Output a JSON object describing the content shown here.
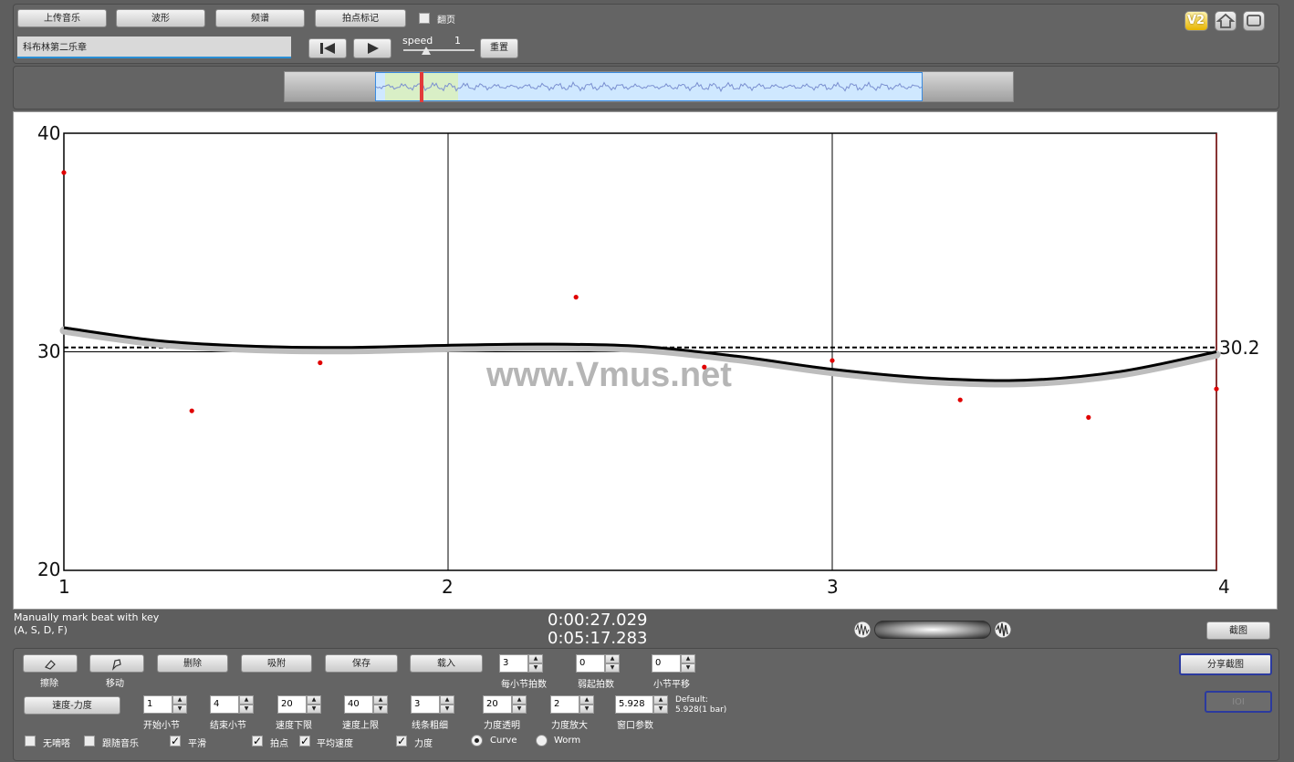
{
  "toolbar": {
    "upload_label": "上传音乐",
    "waveform_label": "波形",
    "spectrum_label": "频谱",
    "beat_mark_label": "拍点标记",
    "page_turn_label": "翻页",
    "reset_label": "重置",
    "speed_label": "speed",
    "speed_value": "1",
    "song_title": "科布林第二乐章"
  },
  "top_icons": {
    "version_badge": "V2",
    "home": "home-icon",
    "fullscreen": "screen-icon"
  },
  "chart_data": {
    "type": "scatter",
    "title": "",
    "xlabel": "",
    "ylabel": "",
    "xlim": [
      1,
      4
    ],
    "ylim": [
      20,
      40
    ],
    "x_ticks": [
      "1",
      "2",
      "3",
      "4"
    ],
    "y_ticks": [
      "20",
      "30",
      "40"
    ],
    "avg_tempo_label": "30.2",
    "avg_tempo": 30.2,
    "watermark": "www.Vmus.net",
    "series": [
      {
        "type": "scatter",
        "color": "#e00000",
        "points": [
          [
            1.0,
            38.2
          ],
          [
            1.333,
            27.3
          ],
          [
            1.667,
            29.5
          ],
          [
            2.333,
            32.5
          ],
          [
            2.667,
            29.3
          ],
          [
            3.0,
            29.6
          ],
          [
            3.333,
            27.8
          ],
          [
            3.667,
            27.0
          ],
          [
            4.0,
            28.3
          ]
        ]
      },
      {
        "type": "line",
        "color": "#000000",
        "points": [
          [
            1.0,
            31.1
          ],
          [
            1.25,
            30.5
          ],
          [
            1.5,
            30.25
          ],
          [
            1.75,
            30.2
          ],
          [
            2.0,
            30.3
          ],
          [
            2.25,
            30.35
          ],
          [
            2.5,
            30.25
          ],
          [
            2.75,
            29.8
          ],
          [
            3.0,
            29.2
          ],
          [
            3.25,
            28.8
          ],
          [
            3.5,
            28.7
          ],
          [
            3.75,
            29.1
          ],
          [
            4.0,
            30.0
          ]
        ]
      }
    ]
  },
  "time": {
    "current": "0:00:27.029",
    "total": "0:05:17.283"
  },
  "hint": {
    "line1": "Manually mark beat with key",
    "line2": "(A, S, D, F)"
  },
  "screenshot_label": "截图",
  "share_label": "分享截图",
  "ioi_label": "IOI",
  "controls": {
    "erase_label": "擦除",
    "move_label": "移动",
    "delete_label": "删除",
    "snap_label": "吸附",
    "save_label": "保存",
    "load_label": "载入",
    "tempo_dyn_label": "速度-力度",
    "beats_per_bar": {
      "label": "每小节拍数",
      "value": "3"
    },
    "upbeat": {
      "label": "弱起拍数",
      "value": "0"
    },
    "bar_shift": {
      "label": "小节平移",
      "value": "0"
    },
    "start_bar": {
      "label": "开始小节",
      "value": "1"
    },
    "end_bar": {
      "label": "结束小节",
      "value": "4"
    },
    "tempo_min": {
      "label": "速度下限",
      "value": "20"
    },
    "tempo_max": {
      "label": "速度上限",
      "value": "40"
    },
    "line_width": {
      "label": "线条粗细",
      "value": "3"
    },
    "dyn_alpha": {
      "label": "力度透明",
      "value": "20"
    },
    "dyn_zoom": {
      "label": "力度放大",
      "value": "2"
    },
    "window_param": {
      "label": "窗口参数",
      "value": "5.928"
    },
    "default_line1": "Default:",
    "default_line2": "5.928(1 bar)",
    "metronome_label": "无嘀嗒",
    "follow_label": "跟随音乐",
    "smooth_label": "平滑",
    "beat_label": "拍点",
    "avg_tempo_label": "平均速度",
    "dynamics_label": "力度",
    "curve_label": "Curve",
    "worm_label": "Worm"
  }
}
